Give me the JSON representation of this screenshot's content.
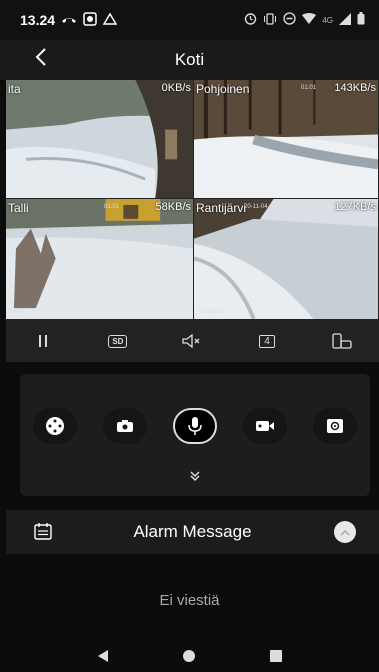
{
  "status_bar": {
    "time": "13.24",
    "network": "4G",
    "icons": [
      "missed-call-icon",
      "photo-app-icon",
      "drive-icon",
      "alarm-icon",
      "vibrate-icon",
      "dnd-icon",
      "wifi-icon",
      "signal-icon",
      "battery-icon"
    ]
  },
  "header": {
    "title": "Koti",
    "back_icon": "back-arrow-icon"
  },
  "cameras": [
    {
      "name": "ita",
      "rate": "0KB/s",
      "timestamp": ""
    },
    {
      "name": "Pohjoinen",
      "rate": "143KB/s",
      "timestamp": "01:01"
    },
    {
      "name": "Talli",
      "rate": "58KB/s",
      "timestamp": "01:01",
      "overlay": "Talli"
    },
    {
      "name": "Rantijärvi",
      "rate": "127KB/s",
      "timestamp": "20-11-04",
      "overlay": "Rantijärvi"
    }
  ],
  "controls": {
    "pause": "pause-icon",
    "quality_label": "SD",
    "mute": "mute-icon",
    "layout_label": "4",
    "rotate": "rotate-screen-icon"
  },
  "actions": [
    "ptz-icon",
    "snapshot-icon",
    "microphone-icon",
    "record-icon",
    "target-icon"
  ],
  "expand_icon": "double-chevron-down-icon",
  "alarm": {
    "title": "Alarm Message",
    "empty_text": "Ei viestiä"
  },
  "nav": [
    "back-triangle-icon",
    "home-circle-icon",
    "recents-square-icon"
  ],
  "colors": {
    "background": "#0c0c0c",
    "panel": "#1d1d1d",
    "text": "#ffffff"
  }
}
